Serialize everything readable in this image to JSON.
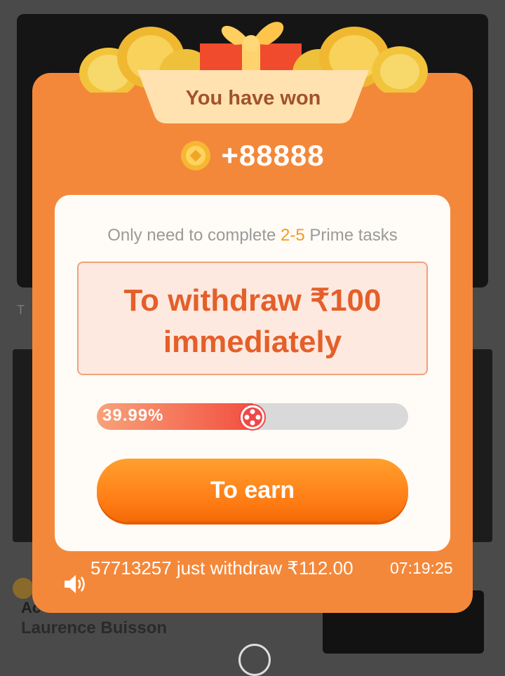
{
  "background": {
    "small_text": "T",
    "card_title_fragment": "Ac",
    "author_name": "Laurence Buisson"
  },
  "popup": {
    "header": "You have won",
    "reward_amount": "+88888",
    "tasks_line": {
      "prefix": "Only need to complete ",
      "highlight": "2-5",
      "suffix": " Prime tasks"
    },
    "withdraw": {
      "line1": "To withdraw ₹100",
      "line2": "immediately"
    },
    "progress": {
      "label": "39.99%",
      "value": 0.3999
    },
    "earn_button_label": "To earn",
    "ticker": {
      "text": "57713257 just withdraw ₹112.00",
      "time": "07:19:25"
    }
  },
  "colors": {
    "popup_orange": "#f4883a",
    "highlight": "#f39a1e",
    "withdraw_text": "#e45f2a",
    "button": "#ff7b14"
  },
  "icons": [
    "coin-icon",
    "gift-icon",
    "speaker-icon",
    "progress-knob-icon"
  ]
}
